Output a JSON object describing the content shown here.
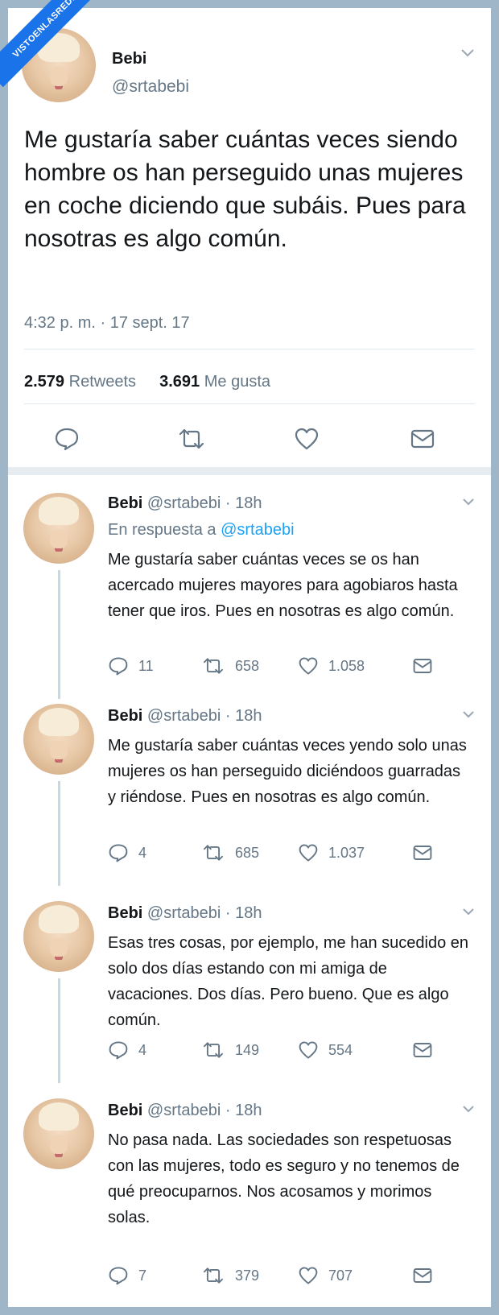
{
  "badge": "VISTOENLASREDES",
  "tweet": {
    "name": "Bebi",
    "handle": "@srtabebi",
    "text": "Me gustaría saber cuántas veces siendo hombre os han perseguido unas mujeres en coche diciendo que subáis. Pues para nosotras es algo común.",
    "time": "4:32 p. m. · 17 sept. 17",
    "retweets_count": "2.579",
    "retweets_label": "Retweets",
    "likes_count": "3.691",
    "likes_label": "Me gusta"
  },
  "replies": [
    {
      "name": "Bebi",
      "meta": "@srtabebi · 18h",
      "in_reply_prefix": "En respuesta a",
      "in_reply_mention": "@srtabebi",
      "text": "Me gustaría saber cuántas veces se os han acercado mujeres mayores para agobiaros hasta tener que iros. Pues en nosotras es algo común.",
      "replies": "11",
      "retweets": "658",
      "likes": "1.058"
    },
    {
      "name": "Bebi",
      "meta": "@srtabebi · 18h",
      "text": "Me gustaría saber cuántas veces yendo solo unas mujeres os han perseguido diciéndoos guarradas y riéndose. Pues en nosotras es algo común.",
      "replies": "4",
      "retweets": "685",
      "likes": "1.037"
    },
    {
      "name": "Bebi",
      "meta": "@srtabebi · 18h",
      "text": "Esas tres cosas, por ejemplo, me han sucedido en solo dos días estando con mi amiga de vacaciones. Dos días. Pero bueno. Que es algo común.",
      "replies": "4",
      "retweets": "149",
      "likes": "554"
    },
    {
      "name": "Bebi",
      "meta": "@srtabebi · 18h",
      "text": "No pasa nada. Las sociedades son respetuosas con las mujeres, todo es seguro y no tenemos de qué preocuparnos. Nos acosamos y morimos solas.",
      "replies": "7",
      "retweets": "379",
      "likes": "707"
    }
  ],
  "icons": {
    "reply": "reply-icon",
    "retweet": "retweet-icon",
    "like": "heart-icon",
    "dm": "envelope-icon",
    "menu": "chevron-down-icon"
  },
  "colors": {
    "link": "#1da1f2",
    "muted": "#657786",
    "text": "#14171a",
    "badge": "#1a73e8"
  }
}
